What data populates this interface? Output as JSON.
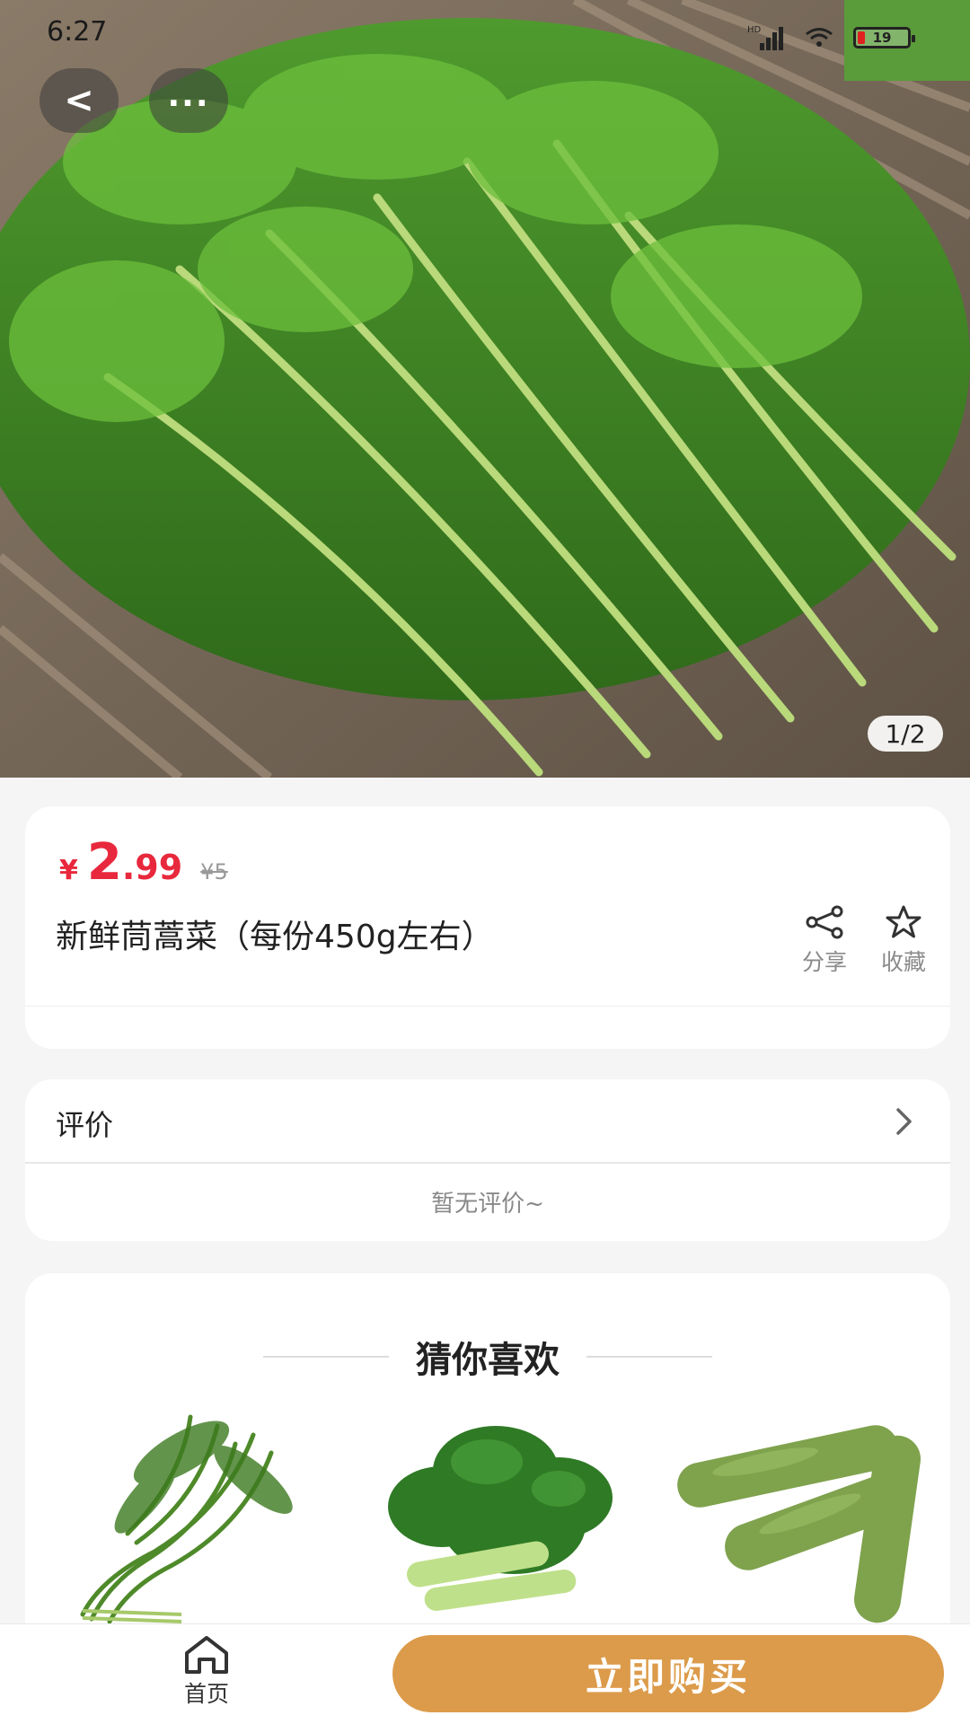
{
  "status_bar": {
    "time": "6:27",
    "network": "HD",
    "battery": "19"
  },
  "hero": {
    "back_label": "<",
    "more_label": "...",
    "pager": "1/2",
    "image_icon": "crown-daisy-greens-photo"
  },
  "product": {
    "currency": "¥",
    "price_int": "2",
    "price_dec": ".99",
    "original_price": "¥5",
    "title": "新鲜茼蒿菜（每份450g左右）",
    "share_label": "分享",
    "favorite_label": "收藏"
  },
  "reviews": {
    "label": "评价",
    "empty_text": "暂无评价~"
  },
  "recommend": {
    "title": "猜你喜欢",
    "items": [
      {
        "icon": "water-spinach-photo"
      },
      {
        "icon": "bok-choy-photo"
      },
      {
        "icon": "fava-beans-photo"
      }
    ]
  },
  "bottom_bar": {
    "home_label": "首页",
    "buy_label": "立即购买"
  },
  "colors": {
    "price": "#e8283c",
    "buy_button": "#dc9b4a",
    "background": "#f5f5f5"
  }
}
